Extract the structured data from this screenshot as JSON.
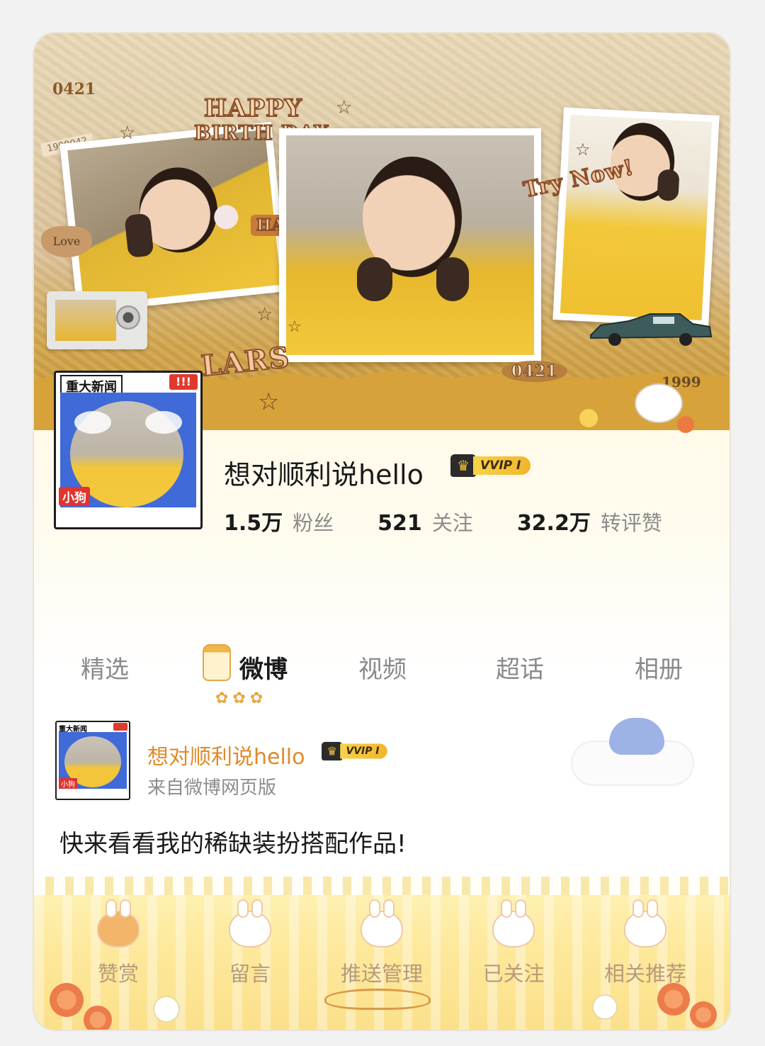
{
  "banner": {
    "number_top_left": "0421",
    "stamp_small": "1999042",
    "headline_1": "HAPPY",
    "headline_2": "BIRTH DAY",
    "sticker_happy": "HAPPY",
    "sticker_love": "Love",
    "sticker_try": "Try Now!",
    "sticker_lars": "LARS",
    "number_bottom": "0421",
    "number_right": "1999"
  },
  "profile": {
    "name": "想对顺利说hello",
    "vip_label": "VVIP Ⅰ",
    "avatar_tag": "重大新闻",
    "avatar_alert": "!!!",
    "avatar_sub": "小狗",
    "stats": [
      {
        "value": "1.5万",
        "label": "粉丝"
      },
      {
        "value": "521",
        "label": "关注"
      },
      {
        "value": "32.2万",
        "label": "转评赞"
      }
    ]
  },
  "tabs": [
    {
      "label": "精选",
      "active": false
    },
    {
      "label": "微博",
      "active": true
    },
    {
      "label": "视频",
      "active": false
    },
    {
      "label": "超话",
      "active": false
    },
    {
      "label": "相册",
      "active": false
    }
  ],
  "post": {
    "author": "想对顺利说hello",
    "vip_label": "VVIP Ⅰ",
    "avatar_tag": "重大新闻",
    "avatar_sub": "小狗",
    "source": "来自微博网页版",
    "text": "快来看看我的稀缺装扮搭配作品!"
  },
  "actions": [
    {
      "label": "赞赏",
      "icon": "fox-icon"
    },
    {
      "label": "留言",
      "icon": "bunny-icon"
    },
    {
      "label": "推送管理",
      "icon": "bunny-icon"
    },
    {
      "label": "已关注",
      "icon": "bunny-icon"
    },
    {
      "label": "相关推荐",
      "icon": "bunny-icon"
    }
  ],
  "colors": {
    "accent_orange": "#e08a2a",
    "vip_gold": "#f2b52a",
    "banner_mustard": "#d6a239"
  }
}
